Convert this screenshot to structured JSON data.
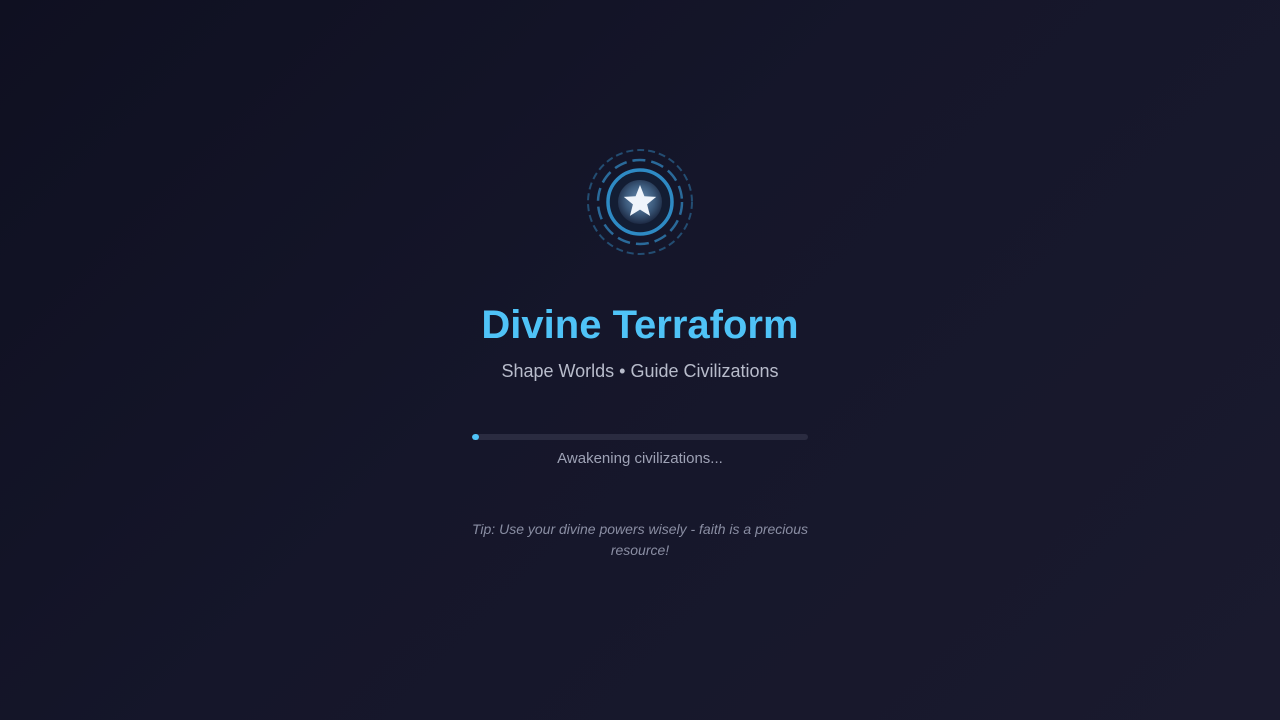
{
  "game": {
    "title": "Divine Terraform",
    "subtitle": "Shape Worlds • Guide Civilizations"
  },
  "emblem": {
    "icon": "star-icon",
    "accent_color": "#4fc3f7",
    "ring_color": "#2e86c1"
  },
  "loading": {
    "progress": 0.006,
    "status_text": "Awakening civilizations..."
  },
  "tip": {
    "text": "Tip: Use your divine powers wisely - faith is a precious resource!"
  }
}
